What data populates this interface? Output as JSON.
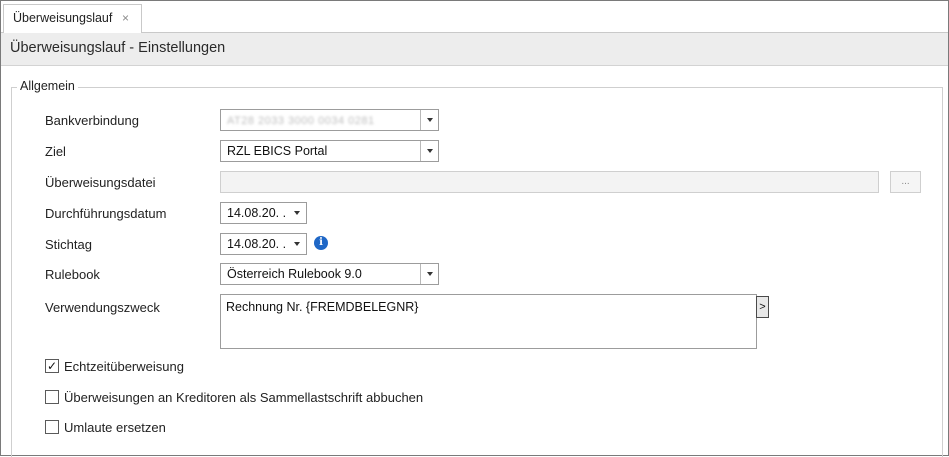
{
  "tab": {
    "label": "Überweisungslauf",
    "close_glyph": "×"
  },
  "header": {
    "title": "Überweisungslauf - Einstellungen"
  },
  "group": {
    "legend": "Allgemein"
  },
  "form": {
    "bankverbindung": {
      "label": "Bankverbindung",
      "value": "AT28 2033 3000 0034 0281"
    },
    "ziel": {
      "label": "Ziel",
      "value": "RZL EBICS Portal"
    },
    "ueberweisungsdatei": {
      "label": "Überweisungsdatei",
      "value": "",
      "button_label": "..."
    },
    "durchfuehrungsdatum": {
      "label": "Durchführungsdatum",
      "value": "14.08.20. ."
    },
    "stichtag": {
      "label": "Stichtag",
      "value": "14.08.20. ."
    },
    "rulebook": {
      "label": "Rulebook",
      "value": "Österreich Rulebook 9.0"
    },
    "verwendungszweck": {
      "label": "Verwendungszweck",
      "value": "Rechnung Nr. {FREMDBELEGNR}",
      "expand_label": ">"
    }
  },
  "checkboxes": [
    {
      "label": "Echtzeitüberweisung",
      "checked": true
    },
    {
      "label": "Überweisungen an Kreditoren als Sammellastschrift abbuchen",
      "checked": false
    },
    {
      "label": "Umlaute ersetzen",
      "checked": false
    }
  ],
  "icons": {
    "info": "info-icon",
    "close": "close-icon",
    "dropdown": "chevron-down-icon"
  },
  "colors": {
    "accent": "#1f67c6",
    "header_bg": "#ededed"
  }
}
